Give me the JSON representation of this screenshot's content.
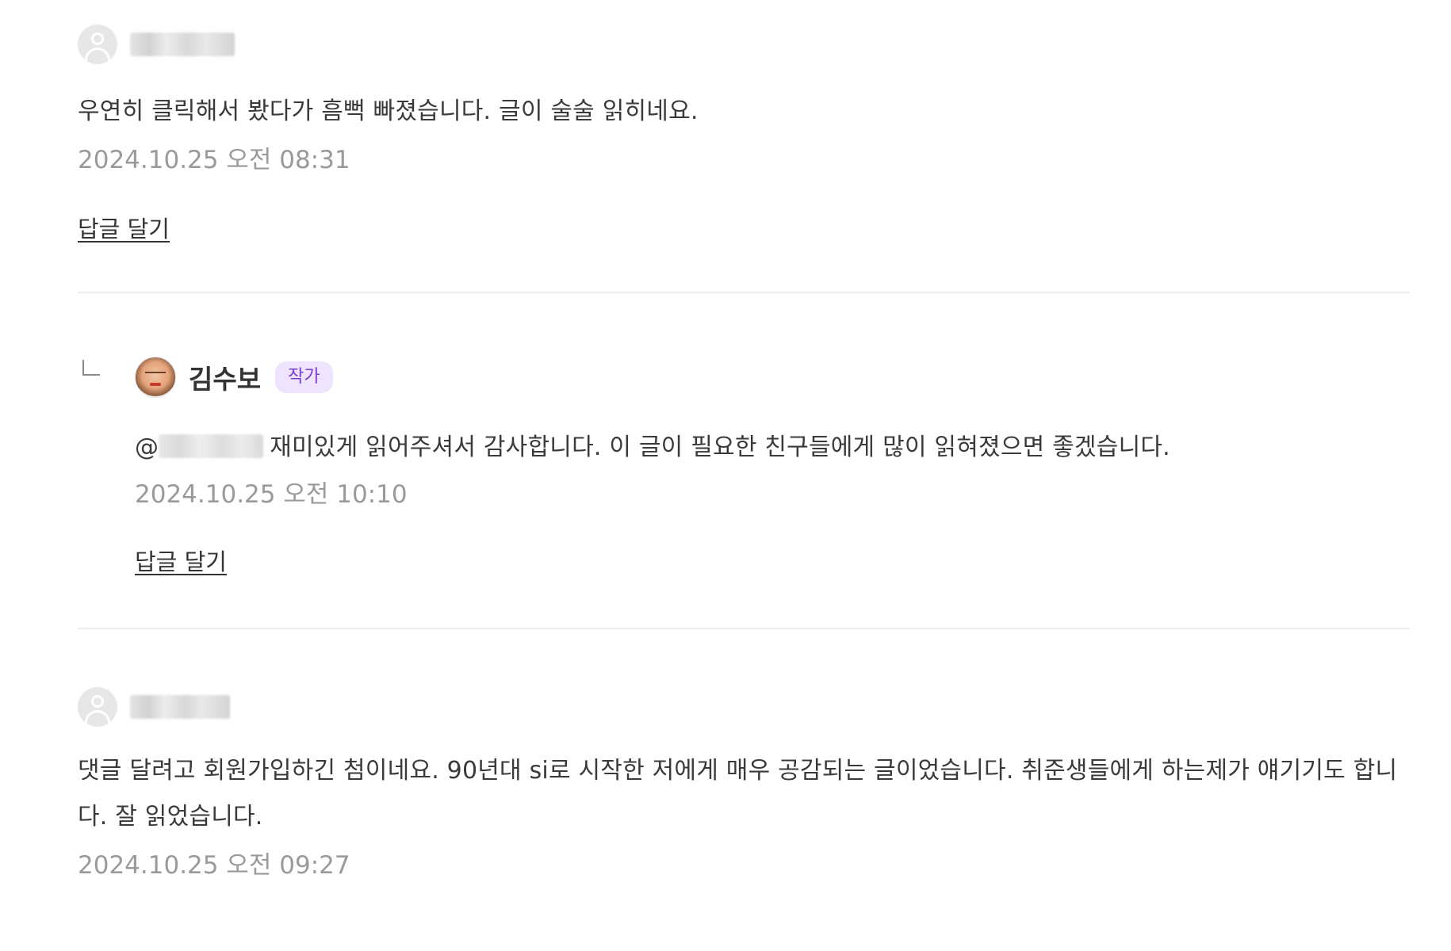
{
  "comments": [
    {
      "text": "우연히 클릭해서 봤다가 흠뻑 빠졌습니다. 글이 술술 읽히네요.",
      "date": "2024.10.25 오전 08:31",
      "reply_label": "답글 달기",
      "replies": [
        {
          "author": "김수보",
          "badge": "작가",
          "mention_prefix": "@",
          "text": "재미있게 읽어주셔서 감사합니다. 이 글이 필요한 친구들에게 많이 읽혀졌으면 좋겠습니다.",
          "date": "2024.10.25 오전 10:10",
          "reply_label": "답글 달기"
        }
      ]
    },
    {
      "text": "댓글 달려고 회원가입하긴 첨이네요. 90년대 si로 시작한 저에게 매우 공감되는 글이었습니다. 취준생들에게 하는제가  얘기기도 합니다. 잘 읽었습니다.",
      "date": "2024.10.25 오전 09:27"
    }
  ],
  "icons": {
    "default_avatar": "user-avatar-icon",
    "reply_indicator": "reply-arrow-icon"
  },
  "colors": {
    "badge_text": "#7b3fd6",
    "badge_bg": "#efe4ff",
    "date_text": "#9a9a9a",
    "divider": "#ececec"
  }
}
